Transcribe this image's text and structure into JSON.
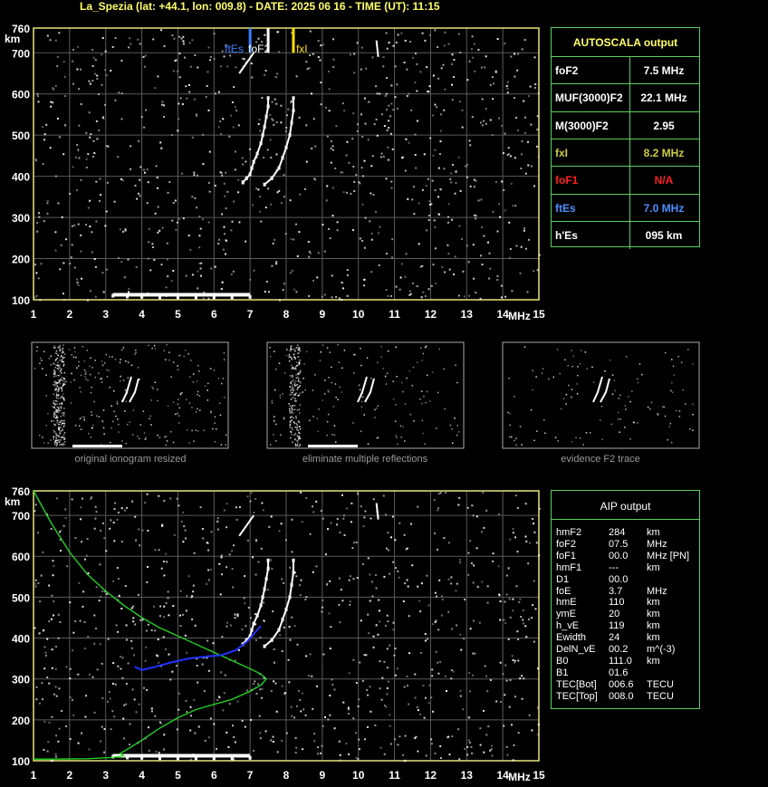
{
  "header": "La_Spezia (lat: +44.1, lon: 009.8) - DATE: 2025 06 16 - TIME (UT): 11:15",
  "axis": {
    "y_unit": "km",
    "x_unit": "MHz",
    "y_ticks": [
      "760",
      "700",
      "600",
      "500",
      "400",
      "300",
      "200",
      "100"
    ],
    "x_ticks": [
      "1",
      "2",
      "3",
      "4",
      "5",
      "6",
      "7",
      "8",
      "9",
      "10",
      "11",
      "12",
      "13",
      "14",
      "15"
    ]
  },
  "markers": {
    "ftes": "ftEs",
    "fof2": "foF2",
    "fxi": "fxI"
  },
  "autoscala": {
    "title": "AUTOSCALA output",
    "rows": [
      {
        "name": "foF2",
        "value": "7.5 MHz",
        "color": "#ffffff"
      },
      {
        "name": "MUF(3000)F2",
        "value": "22.1 MHz",
        "color": "#ffffff"
      },
      {
        "name": "M(3000)F2",
        "value": "2.95",
        "color": "#ffffff"
      },
      {
        "name": "fxI",
        "value": "8.2 MHz",
        "color": "#cccc44"
      },
      {
        "name": "foF1",
        "value": "N/A",
        "color": "#ff2020"
      },
      {
        "name": "ftEs",
        "value": "7.0 MHz",
        "color": "#4a90ff"
      },
      {
        "name": "h'Es",
        "value": "095     km",
        "color": "#ffffff"
      }
    ]
  },
  "captions": [
    "original ionogram resized",
    "eliminate multiple reflections",
    "evidence F2 trace"
  ],
  "aip": {
    "title": "AIP output",
    "rows": [
      {
        "name": "hmF2",
        "value": "284",
        "unit": "km"
      },
      {
        "name": "foF2",
        "value": "07.5",
        "unit": "MHz"
      },
      {
        "name": "foF1",
        "value": "00.0",
        "unit": "MHz   [PN]"
      },
      {
        "name": "hmF1",
        "value": "---",
        "unit": "km"
      },
      {
        "name": "D1",
        "value": "00.0",
        "unit": ""
      },
      {
        "name": "foE",
        "value": "3.7",
        "unit": "MHz"
      },
      {
        "name": "hmE",
        "value": "110",
        "unit": "km"
      },
      {
        "name": "ymE",
        "value": "20",
        "unit": "km"
      },
      {
        "name": "h_vE",
        "value": "119",
        "unit": "km"
      },
      {
        "name": "Ewidth",
        "value": "24",
        "unit": "km"
      },
      {
        "name": "DelN_vE",
        "value": "00.2",
        "unit": "m^(-3)"
      },
      {
        "name": "B0",
        "value": "111.0",
        "unit": "km"
      },
      {
        "name": "B1",
        "value": "01.6",
        "unit": ""
      },
      {
        "name": "TEC[Bot]",
        "value": "006.6",
        "unit": "TECU"
      },
      {
        "name": "TEC[Top]",
        "value": "008.0",
        "unit": "TECU"
      }
    ]
  },
  "chart_data": [
    {
      "type": "scatter",
      "title": "",
      "xlabel": "MHz",
      "ylabel": "km",
      "xlim": [
        1,
        15
      ],
      "ylim": [
        100,
        760
      ],
      "grid": true,
      "series": [
        {
          "values": "echo traces",
          "x": [
            6.8,
            6.9,
            7.0,
            7.05,
            7.1,
            7.2,
            7.3,
            7.35,
            7.4,
            7.45,
            7.5,
            7.5,
            7.4,
            7.6,
            7.8,
            7.9,
            8.0,
            8.1,
            8.15,
            8.2,
            8.2,
            3.2,
            3.6,
            4.0,
            4.5,
            5.0,
            5.5,
            6.0,
            6.5,
            7.0
          ],
          "y": [
            385,
            395,
            405,
            420,
            435,
            455,
            480,
            500,
            520,
            545,
            570,
            590,
            380,
            395,
            420,
            445,
            470,
            500,
            530,
            560,
            590,
            110,
            108,
            107,
            106,
            106,
            106,
            106,
            106,
            107
          ]
        }
      ]
    },
    {
      "type": "line",
      "title": "",
      "xlabel": "MHz",
      "ylabel": "km",
      "xlim": [
        1,
        15
      ],
      "ylim": [
        100,
        760
      ],
      "series": [
        {
          "x": [
            1.0,
            1.5,
            2.0,
            2.5,
            3.0,
            3.5,
            4.0,
            4.5,
            5.0,
            5.5,
            6.0,
            6.5,
            7.0,
            7.3,
            7.45,
            7.3,
            7.0,
            6.5,
            6.0,
            5.5,
            5.0,
            4.5,
            4.0,
            3.6,
            3.4,
            3.5,
            3.2,
            2.5,
            1.5,
            1.0
          ],
          "y": [
            760,
            680,
            610,
            555,
            515,
            480,
            450,
            425,
            405,
            385,
            365,
            345,
            325,
            312,
            300,
            285,
            270,
            250,
            238,
            225,
            205,
            180,
            150,
            128,
            118,
            112,
            108,
            105,
            104,
            104
          ]
        },
        {
          "x": [
            3.8,
            4.0,
            4.3,
            4.8,
            5.3,
            5.8,
            6.2,
            6.6,
            6.9,
            7.1,
            7.3
          ],
          "y": [
            330,
            322,
            328,
            340,
            350,
            355,
            358,
            370,
            390,
            410,
            430
          ]
        }
      ]
    }
  ]
}
